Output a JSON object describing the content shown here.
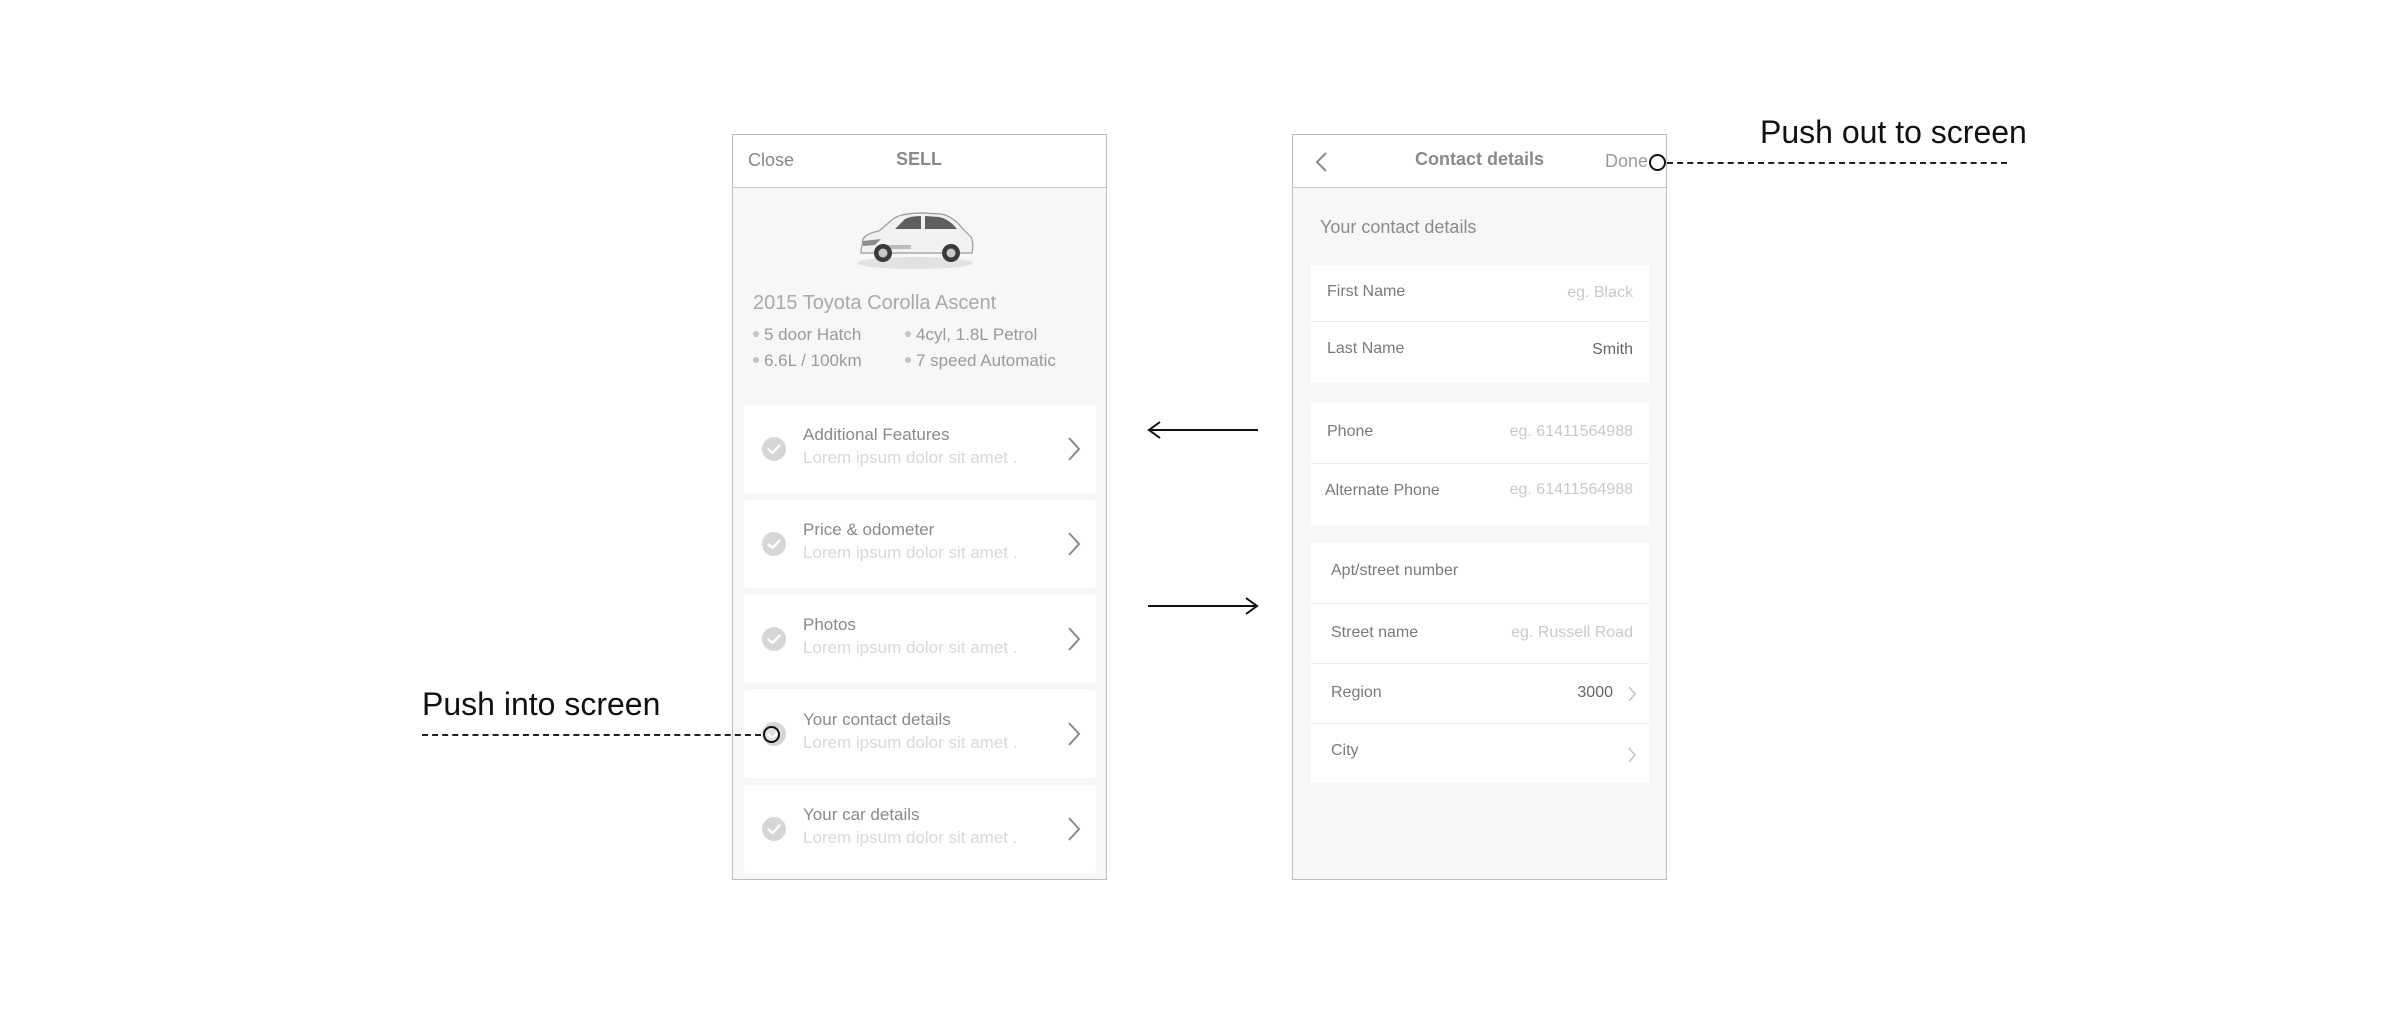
{
  "sell_screen": {
    "close_label": "Close",
    "title": "SELL",
    "car_title": "2015 Toyota Corolla Ascent",
    "specs": [
      "5 door Hatch",
      "4cyl, 1.8L Petrol",
      "6.6L / 100km",
      "7 speed Automatic"
    ],
    "items": [
      {
        "title": "Additional Features",
        "subtitle": "Lorem ipsum dolor sit amet ."
      },
      {
        "title": "Price & odometer",
        "subtitle": "Lorem ipsum dolor sit amet ."
      },
      {
        "title": "Photos",
        "subtitle": "Lorem ipsum dolor sit amet ."
      },
      {
        "title": "Your contact details",
        "subtitle": "Lorem ipsum dolor sit amet ."
      },
      {
        "title": "Your car details",
        "subtitle": "Lorem ipsum dolor sit amet ."
      }
    ]
  },
  "contact_screen": {
    "title": "Contact details",
    "done_label": "Done",
    "section_label": "Your contact details",
    "first_name": {
      "label": "First Name",
      "placeholder": "eg. Black"
    },
    "last_name": {
      "label": "Last Name",
      "value": "Smith"
    },
    "phone": {
      "label": "Phone",
      "placeholder": "eg. 61411564988"
    },
    "alt_phone": {
      "label": "Alternate Phone",
      "placeholder": "eg. 61411564988"
    },
    "street_number": {
      "label": "Apt/street number"
    },
    "street_name": {
      "label": "Street name",
      "placeholder": "eg. Russell Road"
    },
    "region": {
      "label": "Region",
      "value": "3000"
    },
    "city": {
      "label": "City"
    }
  },
  "annotations": {
    "push_into": "Push into screen",
    "push_out": "Push out to screen"
  },
  "icons": {
    "back": "chevron-left-icon",
    "chevron": "chevron-right-icon",
    "check": "check-circle-icon",
    "arrow_left": "arrow-left-icon",
    "arrow_right": "arrow-right-icon"
  }
}
